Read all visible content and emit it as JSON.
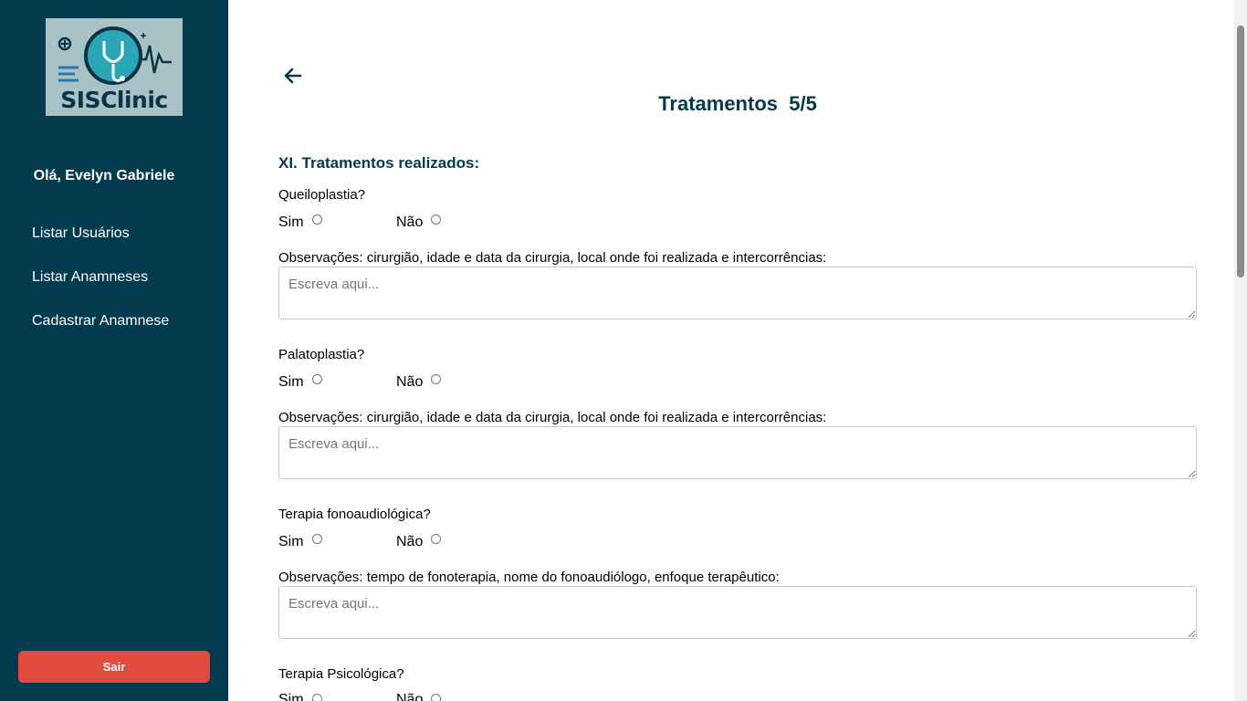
{
  "sidebar": {
    "logo_text": "SISClinic",
    "greeting": "Olá, Evelyn Gabriele",
    "nav": [
      {
        "label": "Listar Usuários"
      },
      {
        "label": "Listar Anamneses"
      },
      {
        "label": "Cadastrar Anamnese"
      }
    ],
    "logout_label": "Sair",
    "colors": {
      "background": "#023a4e",
      "logout": "#e24b3d"
    }
  },
  "main": {
    "back_icon": "arrow-left-icon",
    "title": "Tratamentos  5/5",
    "section_title": "XI. Tratamentos realizados:",
    "option_yes": "Sim",
    "option_no": "Não",
    "placeholder": "Escreva aqui...",
    "questions": [
      {
        "label": "Queiloplastia?",
        "obs": "Observações: cirurgião, idade e data da cirurgia, local onde foi realizada e intercorrências:"
      },
      {
        "label": "Palatoplastia?",
        "obs": "Observações: cirurgião, idade e data da cirurgia, local onde foi realizada e intercorrências:"
      },
      {
        "label": "Terapia fonoaudiológica?",
        "obs": "Observações: tempo de fonoterapia, nome do fonoaudiólogo, enfoque terapêutico:"
      },
      {
        "label": "Terapia Psicológica?"
      }
    ]
  }
}
